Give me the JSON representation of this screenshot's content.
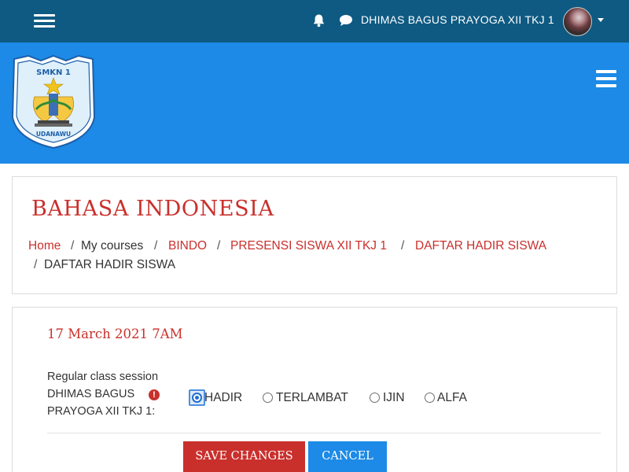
{
  "topbar": {
    "username": "DHIMAS BAGUS PRAYOGA XII TKJ 1",
    "icons": {
      "menu": "hamburger-icon",
      "notifications": "bell-icon",
      "messages": "chat-icon",
      "user_menu": "caret-down-icon"
    },
    "colors": {
      "background": "#0e5a82"
    }
  },
  "banner": {
    "logo": {
      "top_text": "SMKN 1",
      "bottom_text": "UDANAWU"
    },
    "colors": {
      "background": "#1c8ae6"
    }
  },
  "course": {
    "title": "BAHASA INDONESIA",
    "breadcrumb": [
      {
        "label": "Home",
        "link": true
      },
      {
        "label": "My courses",
        "link": false
      },
      {
        "label": "BINDO",
        "link": true
      },
      {
        "label": "PRESENSI SISWA XII TKJ 1",
        "link": true
      },
      {
        "label": "DAFTAR HADIR SISWA",
        "link": true
      },
      {
        "label": "DAFTAR HADIR SISWA",
        "link": false
      }
    ],
    "separator": "/"
  },
  "attendance": {
    "session_title": "17 March 2021 7AM",
    "session_type": "Regular class session",
    "student_label_line1": "DHIMAS BAGUS",
    "student_label_line2": "PRAYOGA XII TKJ 1:",
    "required_icon": "exclamation-icon",
    "options": [
      {
        "label": "HADIR",
        "checked": true
      },
      {
        "label": "TERLAMBAT",
        "checked": false
      },
      {
        "label": "IJIN",
        "checked": false
      },
      {
        "label": "ALFA",
        "checked": false
      }
    ],
    "save_label": "SAVE CHANGES",
    "cancel_label": "CANCEL"
  },
  "colors": {
    "accent": "#c9302c",
    "primary": "#1c8ae6"
  }
}
